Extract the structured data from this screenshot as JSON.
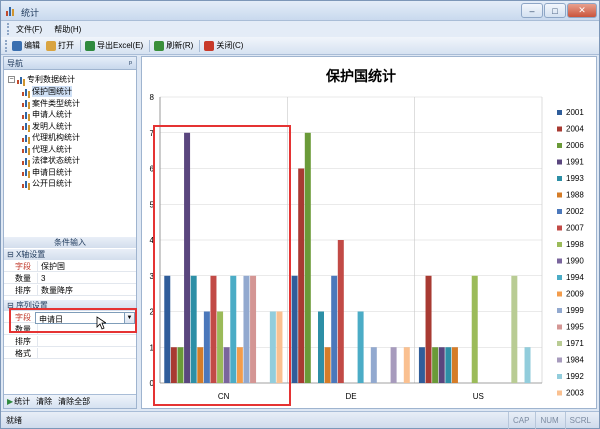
{
  "window": {
    "title": "统计"
  },
  "menu": {
    "items": [
      "文件(F)",
      "帮助(H)"
    ]
  },
  "toolbar": {
    "buttons": [
      {
        "label": "编辑",
        "icon": "edit-icon",
        "color": "#3a6fb0"
      },
      {
        "label": "打开",
        "icon": "open-icon",
        "color": "#d9a441"
      },
      {
        "label": "导出Excel(E)",
        "icon": "excel-icon",
        "color": "#2f8a3e"
      },
      {
        "label": "刷新(R)",
        "icon": "refresh-icon",
        "color": "#3a8f3a"
      },
      {
        "label": "关闭(C)",
        "icon": "close-icon",
        "color": "#c83a2a"
      }
    ]
  },
  "nav": {
    "header": "导航",
    "pin": "ᵖ",
    "root": "专利数据统计",
    "items": [
      "保护国统计",
      "案件类型统计",
      "申请人统计",
      "发明人统计",
      "代理机构统计",
      "代理人统计",
      "法律状态统计",
      "申请日统计",
      "公开日统计"
    ],
    "selected_index": 0
  },
  "conditions": {
    "header": "条件输入",
    "x_section": "X轴设置",
    "x_rows": [
      {
        "key": "字段",
        "value": "保护国",
        "red": true
      },
      {
        "key": "数量",
        "value": "3",
        "red": false
      },
      {
        "key": "排序",
        "value": "数量降序",
        "red": false
      }
    ],
    "series_section": "序列设置",
    "series_rows": [
      {
        "key": "字段",
        "value": "申请日",
        "red": true
      },
      {
        "key": "数量",
        "value": "",
        "red": false
      },
      {
        "key": "排序",
        "value": "",
        "red": false
      },
      {
        "key": "格式",
        "value": "",
        "red": false
      }
    ]
  },
  "bottom_bar": {
    "stats": "统计",
    "clear": "清除",
    "clear_all": "清除全部"
  },
  "status": {
    "ready": "就绪",
    "keys": [
      "CAP",
      "NUM",
      "SCRL"
    ]
  },
  "chart_data": {
    "type": "bar",
    "title": "保护国统计",
    "categories": [
      "CN",
      "DE",
      "US"
    ],
    "ylim": [
      0,
      8
    ],
    "yticks": [
      0,
      1,
      2,
      3,
      4,
      5,
      6,
      7,
      8
    ],
    "grid": true,
    "legend_position": "right",
    "series": [
      {
        "name": "2001",
        "color": "#2f5d9a",
        "values": [
          3,
          3,
          1
        ]
      },
      {
        "name": "2004",
        "color": "#a83a32",
        "values": [
          1,
          6,
          3
        ]
      },
      {
        "name": "2006",
        "color": "#6a9a38",
        "values": [
          1,
          7,
          1
        ]
      },
      {
        "name": "1991",
        "color": "#5a467e",
        "values": [
          7,
          0,
          1
        ]
      },
      {
        "name": "1993",
        "color": "#2d8fa6",
        "values": [
          3,
          2,
          1
        ]
      },
      {
        "name": "1988",
        "color": "#d57c28",
        "values": [
          1,
          1,
          1
        ]
      },
      {
        "name": "2002",
        "color": "#4b78bb",
        "values": [
          2,
          3,
          0
        ]
      },
      {
        "name": "2007",
        "color": "#c24a46",
        "values": [
          3,
          4,
          0
        ]
      },
      {
        "name": "1998",
        "color": "#9bbb59",
        "values": [
          2,
          0,
          3
        ]
      },
      {
        "name": "1990",
        "color": "#7a659d",
        "values": [
          1,
          0,
          0
        ]
      },
      {
        "name": "1994",
        "color": "#4bacc6",
        "values": [
          3,
          2,
          0
        ]
      },
      {
        "name": "2009",
        "color": "#f39c4b",
        "values": [
          1,
          0,
          0
        ]
      },
      {
        "name": "1999",
        "color": "#92a9cf",
        "values": [
          3,
          1,
          0
        ]
      },
      {
        "name": "1995",
        "color": "#d49694",
        "values": [
          3,
          0,
          0
        ]
      },
      {
        "name": "1971",
        "color": "#b9cc94",
        "values": [
          0,
          0,
          3
        ]
      },
      {
        "name": "1984",
        "color": "#a79bbd",
        "values": [
          0,
          1,
          0
        ]
      },
      {
        "name": "1992",
        "color": "#92cddc",
        "values": [
          2,
          0,
          1
        ]
      },
      {
        "name": "2003",
        "color": "#fac090",
        "values": [
          2,
          1,
          0
        ]
      }
    ]
  }
}
